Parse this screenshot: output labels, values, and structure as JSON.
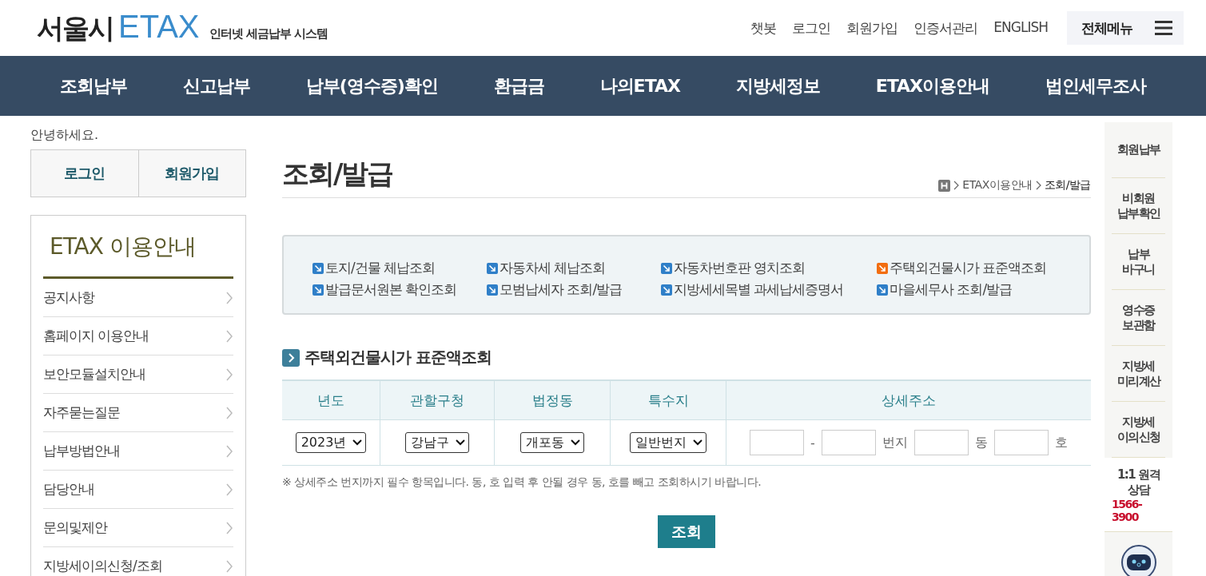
{
  "header": {
    "logo_city": "서울시",
    "logo_brand": "ETAX",
    "logo_tagline": "인터넷 세금납부 시스템",
    "util_links": [
      "챗봇",
      "로그인",
      "회원가입",
      "인증서관리",
      "ENGLISH"
    ],
    "all_menu": "전체메뉴"
  },
  "nav": [
    "조회납부",
    "신고납부",
    "납부(영수증)확인",
    "환급금",
    "나의ETAX",
    "지방세정보",
    "ETAX이용안내",
    "법인세무조사"
  ],
  "sidebar": {
    "greeting": "안녕하세요.",
    "buttons": [
      "로그인",
      "회원가입"
    ],
    "title": "ETAX 이용안내",
    "items": [
      "공지사항",
      "홈페이지 이용안내",
      "보안모듈설치안내",
      "자주묻는질문",
      "납부방법안내",
      "담당안내",
      "문의및제안",
      "지방세이의신청/조회"
    ]
  },
  "page": {
    "title": "조회/발급",
    "breadcrumb": [
      "ETAX이용안내",
      "조회/발급"
    ]
  },
  "quick_links": [
    {
      "label": "토지/건물 체납조회",
      "selected": false
    },
    {
      "label": "자동차세 체납조회",
      "selected": false
    },
    {
      "label": "자동차번호판 영치조회",
      "selected": false
    },
    {
      "label": "주택외건물시가 표준액조회",
      "selected": true
    },
    {
      "label": "발급문서원본 확인조회",
      "selected": false
    },
    {
      "label": "모범납세자 조회/발급",
      "selected": false
    },
    {
      "label": "지방세세목별 과세납세증명서",
      "selected": false
    },
    {
      "label": "마을세무사 조회/발급",
      "selected": false
    }
  ],
  "section_title": "주택외건물시가 표준액조회",
  "form": {
    "columns": [
      "년도",
      "관할구청",
      "법정동",
      "특수지",
      "상세주소"
    ],
    "selects": [
      {
        "value": "2023년"
      },
      {
        "value": "강남구"
      },
      {
        "value": "개포동"
      },
      {
        "value": "일반번지"
      }
    ],
    "address_parts": [
      {
        "kind": "field"
      },
      {
        "kind": "text",
        "text": "-"
      },
      {
        "kind": "field"
      },
      {
        "kind": "text",
        "text": "번지"
      },
      {
        "kind": "field"
      },
      {
        "kind": "text",
        "text": "동"
      },
      {
        "kind": "field"
      },
      {
        "kind": "text",
        "text": "호"
      }
    ],
    "note": "※ 상세주소 번지까지 필수 항목입니다. 동, 호 입력 후 안될 경우 동, 호를 빼고 조회하시기 바랍니다.",
    "submit": "조회"
  },
  "quick_bar": {
    "items": [
      {
        "lines": [
          "회원납부"
        ]
      },
      {
        "lines": [
          "비회원",
          "납부확인"
        ]
      },
      {
        "lines": [
          "납부",
          "바구니"
        ]
      },
      {
        "lines": [
          "영수증",
          "보관함"
        ]
      },
      {
        "lines": [
          "지방세",
          "미리계산"
        ]
      },
      {
        "lines": [
          "지방세",
          "이의신청"
        ]
      },
      {
        "lines": [
          "1:1 원격",
          "상담"
        ],
        "phone": "1566-3900"
      }
    ]
  }
}
